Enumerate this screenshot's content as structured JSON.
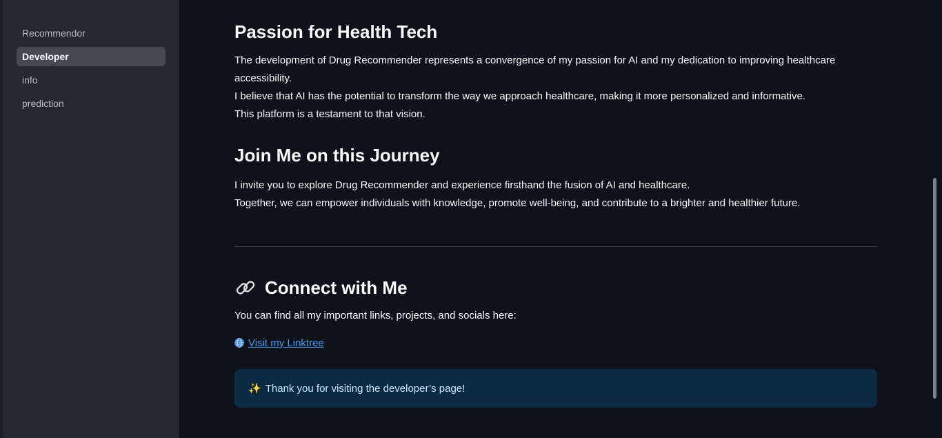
{
  "sidebar": {
    "items": [
      {
        "label": "Recommendor",
        "active": false
      },
      {
        "label": "Developer",
        "active": true
      },
      {
        "label": "info",
        "active": false
      },
      {
        "label": "prediction",
        "active": false
      }
    ]
  },
  "sections": {
    "passion": {
      "title": "Passion for Health Tech",
      "line1": "The development of Drug Recommender represents a convergence of my passion for AI and my dedication to improving healthcare accessibility.",
      "line2": "I believe that AI has the potential to transform the way we approach healthcare, making it more personalized and informative.",
      "line3": "This platform is a testament to that vision."
    },
    "journey": {
      "title": "Join Me on this Journey",
      "line1": "I invite you to explore Drug Recommender and experience firsthand the fusion of AI and healthcare.",
      "line2": "Together, we can empower individuals with knowledge, promote well-being, and contribute to a brighter and healthier future."
    },
    "connect": {
      "icon": "link-icon",
      "title": "Connect with Me",
      "text": "You can find all my important links, projects, and socials here:",
      "link_icon": "globe-icon",
      "link_label": "Visit my Linktree"
    },
    "info_box": {
      "icon": "sparkle-icon",
      "text": "Thank you for visiting the developer’s page!"
    }
  },
  "colors": {
    "background": "#0e1117",
    "sidebar": "#262730",
    "link": "#3d9df3",
    "info_box_bg": "#0c2b43",
    "info_box_text": "#c7ebff"
  }
}
